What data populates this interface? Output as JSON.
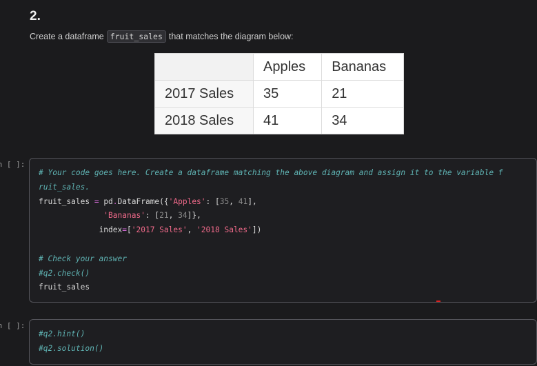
{
  "markdown": {
    "heading": "2.",
    "text_before": "Create a dataframe",
    "inline_code": "fruit_sales",
    "text_after": "that matches the diagram below:"
  },
  "diagram_table": {
    "columns": [
      "Apples",
      "Bananas"
    ],
    "rows": [
      {
        "label": "2017 Sales",
        "values": [
          "35",
          "21"
        ]
      },
      {
        "label": "2018 Sales",
        "values": [
          "41",
          "34"
        ]
      }
    ]
  },
  "cell1": {
    "prompt": "In [ ]:",
    "comment1a": "# Your code goes here. Create a dataframe matching the above diagram and assign it to the variable f",
    "comment1b": "ruit_sales.",
    "l3_a": "fruit_sales ",
    "l3_eq": "=",
    "l3_b": " pd",
    "l3_dot": ".",
    "l3_c": "DataFrame({",
    "l3_s1": "'Apples'",
    "l3_d": ": [",
    "l3_n1": "35",
    "l3_e": ", ",
    "l3_n2": "41",
    "l3_f": "],",
    "l4_indent": "              ",
    "l4_s1": "'Bananas'",
    "l4_d": ": [",
    "l4_n1": "21",
    "l4_e": ", ",
    "l4_n2": "34",
    "l4_f": "]},",
    "l5_indent": "             ",
    "l5_a": "index",
    "l5_eq": "=",
    "l5_b": "[",
    "l5_s1": "'2017 Sales'",
    "l5_c": ", ",
    "l5_s2": "'2018 Sales'",
    "l5_d": "])",
    "comment2": "# Check your answer",
    "comment3": "#q2.check()",
    "l9": "fruit_sales"
  },
  "cell2": {
    "prompt": "In [ ]:",
    "line1": "#q2.hint()",
    "line2": "#q2.solution()"
  }
}
